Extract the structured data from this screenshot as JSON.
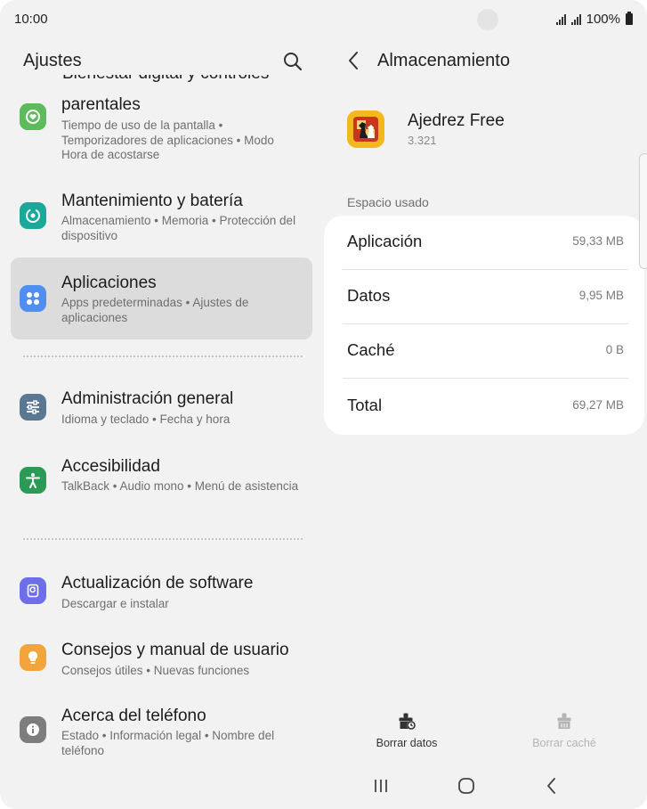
{
  "status_bar": {
    "time": "10:00",
    "battery": "100%",
    "icons": [
      "signal-icon",
      "signal-icon",
      "battery-icon"
    ]
  },
  "settings": {
    "title": "Ajustes",
    "search_icon": "search-icon",
    "cut_off_title": "Bienestar digital y controles",
    "items": [
      {
        "id": "parental",
        "title": "parentales",
        "subtitle": "Tiempo de uso de la pantalla  •  Temporizadores de aplicaciones  •  Modo Hora de acostarse",
        "icon": "digital-wellbeing-icon",
        "color": "#5fba5d",
        "selected": false
      },
      {
        "id": "maintenance",
        "title": "Mantenimiento y batería",
        "subtitle": "Almacenamiento  •  Memoria  •  Protección del dispositivo",
        "icon": "device-care-icon",
        "color": "#1aa89a",
        "selected": false
      },
      {
        "id": "apps",
        "title": "Aplicaciones",
        "subtitle": "Apps predeterminadas  •  Ajustes de aplicaciones",
        "icon": "apps-icon",
        "color": "#4f8ff0",
        "selected": true
      },
      {
        "id": "general",
        "title": "Administración general",
        "subtitle": "Idioma y teclado  •  Fecha y hora",
        "icon": "sliders-icon",
        "color": "#5a7892",
        "selected": false
      },
      {
        "id": "accessibility",
        "title": "Accesibilidad",
        "subtitle": "TalkBack  •  Audio mono  •  Menú de asistencia",
        "icon": "accessibility-icon",
        "color": "#2b9a56",
        "selected": false
      },
      {
        "id": "update",
        "title": "Actualización de software",
        "subtitle": "Descargar e instalar",
        "icon": "software-update-icon",
        "color": "#6d6ee8",
        "selected": false
      },
      {
        "id": "tips",
        "title": "Consejos y manual de usuario",
        "subtitle": "Consejos útiles  •  Nuevas funciones",
        "icon": "lightbulb-icon",
        "color": "#f3a43a",
        "selected": false
      },
      {
        "id": "about",
        "title": "Acerca del teléfono",
        "subtitle": "Estado  •  Información legal  •  Nombre del teléfono",
        "icon": "info-icon",
        "color": "#7d7d7d",
        "selected": false
      }
    ]
  },
  "storage": {
    "title": "Almacenamiento",
    "back_icon": "back-arrow-icon",
    "app": {
      "name": "Ajedrez Free",
      "version": "3.321",
      "icon": "chess-app-icon"
    },
    "section_label": "Espacio usado",
    "rows": [
      {
        "label": "Aplicación",
        "value": "59,33 MB"
      },
      {
        "label": "Datos",
        "value": "9,95 MB"
      },
      {
        "label": "Caché",
        "value": "0 B"
      },
      {
        "label": "Total",
        "value": "69,27 MB"
      }
    ],
    "actions": [
      {
        "label": "Borrar datos",
        "icon": "clear-data-icon",
        "enabled": true
      },
      {
        "label": "Borrar caché",
        "icon": "clear-cache-icon",
        "enabled": false
      }
    ]
  },
  "nav_bar": {
    "buttons": [
      "recent-apps-icon",
      "home-icon",
      "back-icon"
    ]
  },
  "colors": {
    "background": "#f2f2f2",
    "card": "#ffffff",
    "selected_item": "#dcdcdc",
    "action_enabled": "#333333",
    "action_disabled": "#b4b4b4"
  }
}
